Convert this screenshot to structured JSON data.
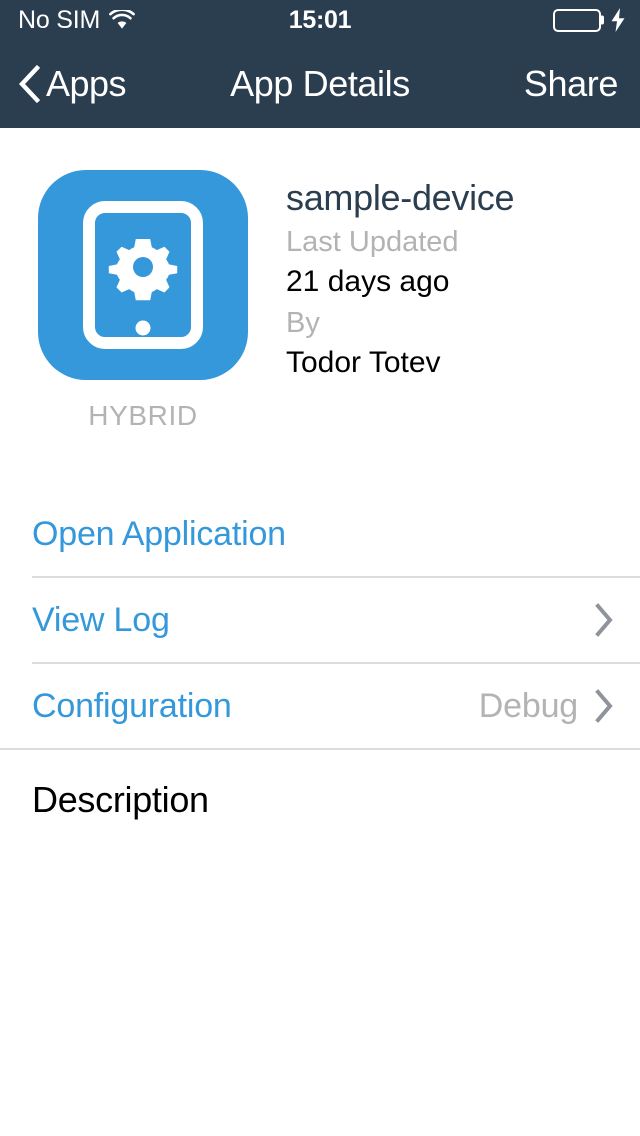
{
  "status_bar": {
    "carrier": "No SIM",
    "wifi_icon": "wifi-icon",
    "time": "15:01",
    "battery_icon": "battery-full-icon",
    "charging_icon": "lightning-bolt-icon"
  },
  "nav_bar": {
    "back_icon": "chevron-left-icon",
    "back_label": "Apps",
    "title": "App Details",
    "action_label": "Share"
  },
  "app": {
    "icon_name": "tablet-gear-icon",
    "icon_color": "#3498db",
    "name": "sample-device",
    "kind_badge": "HYBRID",
    "updated_label": "Last Updated",
    "updated_value": "21 days ago",
    "author_label": "By",
    "author_value": "Todor Totev"
  },
  "actions": [
    {
      "label": "Open Application",
      "value": "",
      "has_chevron": false,
      "separator": "inset",
      "name": "open-application-row"
    },
    {
      "label": "View Log",
      "value": "",
      "has_chevron": true,
      "separator": "inset",
      "name": "view-log-row"
    },
    {
      "label": "Configuration",
      "value": "Debug",
      "has_chevron": true,
      "separator": "full",
      "name": "configuration-row"
    }
  ],
  "description": {
    "title": "Description",
    "body": ""
  },
  "colors": {
    "nav_background": "#2b3e50",
    "accent_blue": "#3498db",
    "muted_gray": "#b3b3b3",
    "separator": "#dcdcdc",
    "battery_green": "#4cd964",
    "chevron_gray": "#8e939c"
  }
}
